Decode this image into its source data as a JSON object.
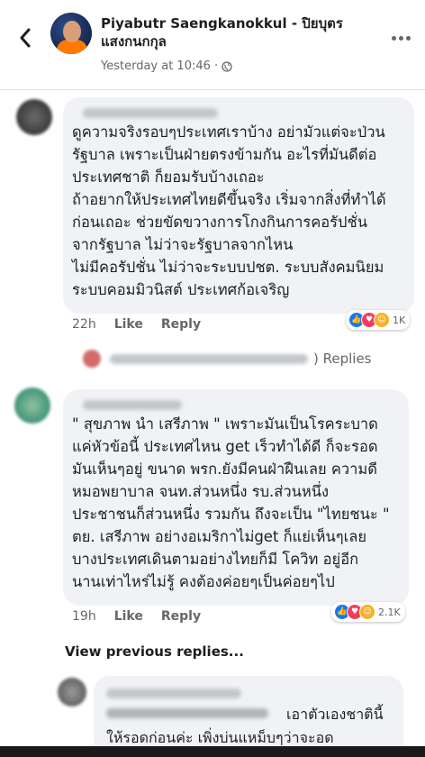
{
  "post": {
    "author": "Piyabutr Saengkanokkul - ปิยบุตร แสงกนกกุล",
    "time": "Yesterday at 10:46 ·"
  },
  "comments": [
    {
      "text": "ดูความจริงรอบๆประเทศเราบ้าง อย่ามัวแต่จะป่วน\nรัฐบาล เพราะเป็นฝ่ายตรงข้ามกัน  อะไรที่มันดีต่อ\nประเทศชาติ ก็ยอมรับบ้างเถอะ\nถ้าอยากให้ประเทศไทยดีขึ้นจริง เริ่มจากสิ่งที่ทำได้\nก่อนเถอะ ช่วยขัดขวางการโกงกินการคอรัปชั่น\nจากรัฐบาล ไม่ว่าจะรัฐบาลจากไหน\nไม่มีคอรัปชั่น ไม่ว่าจะระบบปชต. ระบบสังคมนิยม\nระบบคอมมิวนิสต์ ประเทศก้อเจริญ",
      "time": "22h",
      "like": "Like",
      "reply": "Reply",
      "reaction_count": "1K"
    },
    {
      "text": "\" สุขภาพ นำ เสรีภาพ \" เพราะมันเป็นโรคระบาด\nแค่หัวข้อนี้ ประเทศไหน  get เร็วทำได้ดี ก็จะรอด\nมันเห็นๆอยู่ ขนาด พรก.ยังมีคนฝ่าฝืนเลย ความดี\nหมอพยาบาล จนท.ส่วนหนึ่ง รบ.ส่วนหนึ่ง\nประชาชนก็ส่วนหนึ่ง รวมกัน ถึงจะเป็น \"ไทยชนะ \"\nตย. เสรีภาพ อย่างอเมริกาไม่get ก็แย่เห็นๆเลย\nบางประเทศเดินตามอย่างไทยก็มี  โควิท อยู่อีก\nนานเท่าไหร่ไม่รู้  คงต้องค่อยๆเป็นค่อยๆไป",
      "time": "19h",
      "like": "Like",
      "reply": "Reply",
      "reaction_count": "2.1K"
    }
  ],
  "replies_label": ") Replies",
  "view_previous": "View previous replies...",
  "partial_reply": {
    "line1": "เอาตัวเองชาตินี้",
    "line2": "ให้รอดก่อนค่ะ เพิ่งบ่นแหม็บๆว่าจะอด"
  },
  "colors": {
    "bubble": "#f0f2f5",
    "secondary_text": "#65676b",
    "like_blue": "#1877f2",
    "love_red": "#f33e58",
    "haha_yellow": "#f7b125"
  },
  "icons": [
    "back-arrow-icon",
    "globe-icon",
    "more-options-icon",
    "like-reaction-icon",
    "love-reaction-icon",
    "haha-reaction-icon"
  ]
}
